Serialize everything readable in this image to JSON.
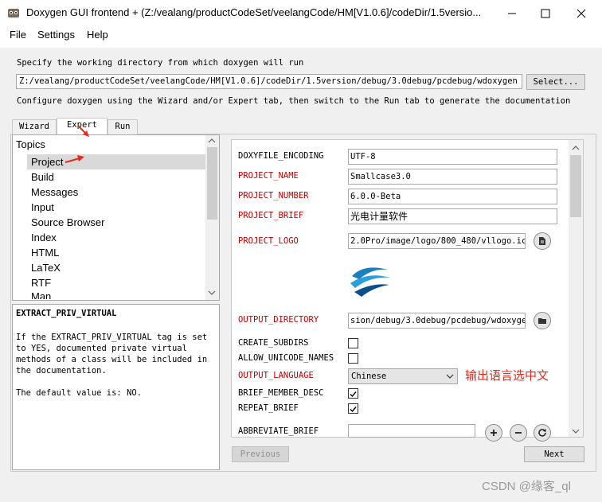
{
  "window": {
    "title": "Doxygen GUI frontend + (Z:/vealang/productCodeSet/veelangCode/HM[V1.0.6]/codeDir/1.5versio..."
  },
  "menu": {
    "file": "File",
    "settings": "Settings",
    "help": "Help"
  },
  "workdir": {
    "prompt": "Specify the working directory from which doxygen will run",
    "value": "Z:/vealang/productCodeSet/veelangCode/HM[V1.0.6]/codeDir/1.5version/debug/3.0debug/pcdebug/wdoxygen",
    "select_label": "Select...",
    "configure_hint": "Configure doxygen using the Wizard and/or Expert tab, then switch to the Run tab to generate the documentation"
  },
  "tabs": [
    "Wizard",
    "Expert",
    "Run"
  ],
  "topics": {
    "header": "Topics",
    "items": [
      "Project",
      "Build",
      "Messages",
      "Input",
      "Source Browser",
      "Index",
      "HTML",
      "LaTeX",
      "RTF",
      "Man"
    ],
    "selected": "Project"
  },
  "help_panel": {
    "title": "EXTRACT_PRIV_VIRTUAL",
    "body": "If the EXTRACT_PRIV_VIRTUAL tag is set to YES, documented private virtual methods of a class will be included in the documentation.",
    "default": "The default value is: NO."
  },
  "options": {
    "doxyfile_encoding": {
      "label": "DOXYFILE_ENCODING",
      "value": "UTF-8"
    },
    "project_name": {
      "label": "PROJECT_NAME",
      "value": "Smallcase3.0"
    },
    "project_number": {
      "label": "PROJECT_NUMBER",
      "value": "6.0.0-Beta"
    },
    "project_brief": {
      "label": "PROJECT_BRIEF",
      "value": "光电计量软件"
    },
    "project_logo": {
      "label": "PROJECT_LOGO",
      "value": "2.0Pro/image/logo/800_480/vllogo.ico"
    },
    "output_directory": {
      "label": "OUTPUT_DIRECTORY",
      "value": "sion/debug/3.0debug/pcdebug/wdoxygen"
    },
    "create_subdirs": {
      "label": "CREATE_SUBDIRS",
      "checked": false
    },
    "allow_unicode_names": {
      "label": "ALLOW_UNICODE_NAMES",
      "checked": false
    },
    "output_language": {
      "label": "OUTPUT_LANGUAGE",
      "value": "Chinese"
    },
    "brief_member_desc": {
      "label": "BRIEF_MEMBER_DESC",
      "checked": true
    },
    "repeat_brief": {
      "label": "REPEAT_BRIEF",
      "checked": true
    },
    "abbreviate_brief": {
      "label": "ABBREVIATE_BRIEF",
      "value": ""
    }
  },
  "annotation": "输出语言选中文",
  "nav": {
    "previous": "Previous",
    "next": "Next"
  },
  "watermark": "CSDN @缘客_ql",
  "colors": {
    "required_label": "#c00000",
    "annotation": "#e8291c",
    "selection": "#d9d9d9"
  }
}
